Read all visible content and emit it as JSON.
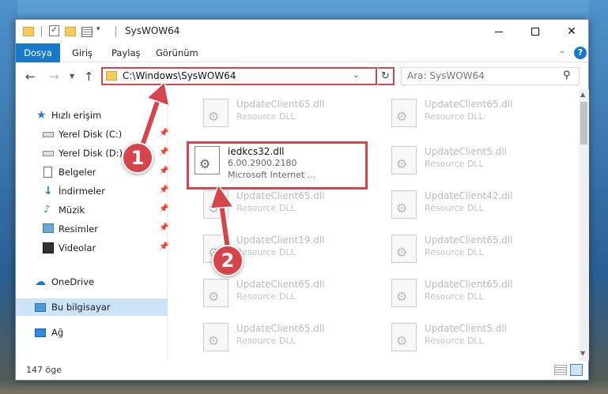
{
  "window": {
    "title": "SysWOW64",
    "min_glyph": "—",
    "close_glyph": "✕"
  },
  "ribbon": {
    "tabs": [
      "Dosya",
      "Giriş",
      "Paylaş",
      "Görünüm"
    ]
  },
  "address": {
    "path": "C:\\Windows\\SysWOW64",
    "search_placeholder": "Ara: SysWOW64"
  },
  "nav": {
    "items": [
      {
        "label": "Hızlı erişim",
        "icon": "star-icon"
      },
      {
        "label": "Yerel Disk (C:)",
        "icon": "drive-icon",
        "pinned": true
      },
      {
        "label": "Yerel Disk (D:)",
        "icon": "drive-icon",
        "pinned": true
      },
      {
        "label": "Belgeler",
        "icon": "documents-icon",
        "pinned": true
      },
      {
        "label": "İndirmeler",
        "icon": "download-icon",
        "pinned": true
      },
      {
        "label": "Müzik",
        "icon": "music-icon",
        "pinned": true
      },
      {
        "label": "Resimler",
        "icon": "pictures-icon",
        "pinned": true
      },
      {
        "label": "Videolar",
        "icon": "videos-icon",
        "pinned": true
      },
      {
        "label": "OneDrive",
        "icon": "onedrive-icon"
      },
      {
        "label": "Bu bilgisayar",
        "icon": "this-pc-icon",
        "selected": true
      },
      {
        "label": "Ağ",
        "icon": "network-icon"
      }
    ]
  },
  "files": [
    {
      "name": "UpdateClient65.dll",
      "type": "Resource DLL"
    },
    {
      "name": "UpdateClient65.dll",
      "type": "Resource DLL"
    },
    {
      "name": "iedkcs32.dll",
      "version": "6.00.2900.2180",
      "company": "Microsoft Internet ...",
      "highlighted": true
    },
    {
      "name": "UpdateClient5.dll",
      "type": "Resource DLL"
    },
    {
      "name": "UpdateClient65.dll",
      "type": "Resource DLL"
    },
    {
      "name": "UpdateClient42.dll",
      "type": "Resource DLL"
    },
    {
      "name": "UpdateClient19.dll",
      "type": "Resource DLL"
    },
    {
      "name": "UpdateClient65.dll",
      "type": "Resource DLL"
    },
    {
      "name": "UpdateClient65.dll",
      "type": "Resource DLL"
    },
    {
      "name": "UpdateClient65.dll",
      "type": "Resource DLL"
    },
    {
      "name": "UpdateClient65.dll",
      "type": "Resource DLL"
    },
    {
      "name": "UpdateClient5.dll",
      "type": "Resource DLL"
    }
  ],
  "status": {
    "item_count": "147 öge"
  },
  "annotations": {
    "step1": "1",
    "step2": "2",
    "color": "#d6454b"
  }
}
